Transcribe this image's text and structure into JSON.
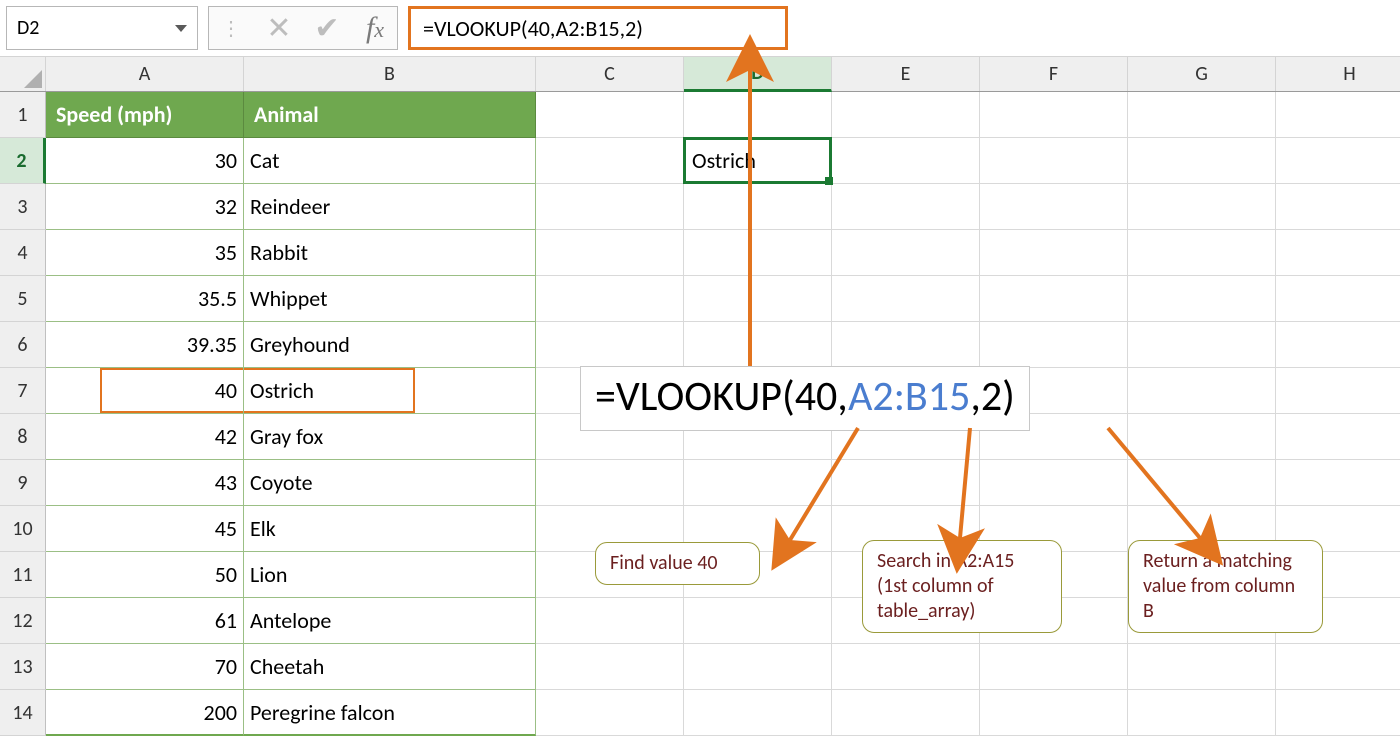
{
  "name_box": "D2",
  "formula_bar": "=VLOOKUP(40,A2:B15,2)",
  "columns": [
    "A",
    "B",
    "C",
    "D",
    "E",
    "F",
    "G",
    "H"
  ],
  "active_column": "D",
  "active_row": 2,
  "row_numbers": [
    1,
    2,
    3,
    4,
    5,
    6,
    7,
    8,
    9,
    10,
    11,
    12,
    13,
    14
  ],
  "table": {
    "headers": {
      "a": "Speed (mph)",
      "b": "Animal"
    },
    "rows": [
      {
        "a": "30",
        "b": "Cat"
      },
      {
        "a": "32",
        "b": "Reindeer"
      },
      {
        "a": "35",
        "b": "Rabbit"
      },
      {
        "a": "35.5",
        "b": "Whippet"
      },
      {
        "a": "39.35",
        "b": "Greyhound"
      },
      {
        "a": "40",
        "b": "Ostrich"
      },
      {
        "a": "42",
        "b": "Gray fox"
      },
      {
        "a": "43",
        "b": "Coyote"
      },
      {
        "a": "45",
        "b": "Elk"
      },
      {
        "a": "50",
        "b": "Lion"
      },
      {
        "a": "61",
        "b": "Antelope"
      },
      {
        "a": "70",
        "b": "Cheetah"
      },
      {
        "a": "200",
        "b": "Peregrine falcon"
      }
    ]
  },
  "selected_cell_value": "Ostrich",
  "big_formula": {
    "p1": "=VLOOKUP(40,",
    "p2": "A2:B15",
    "p3": ",2)"
  },
  "callouts": {
    "c1": "Find value 40",
    "c2": "Search in A2:A15 (1st column of table_array)",
    "c3": "Return a matching value from column B"
  }
}
